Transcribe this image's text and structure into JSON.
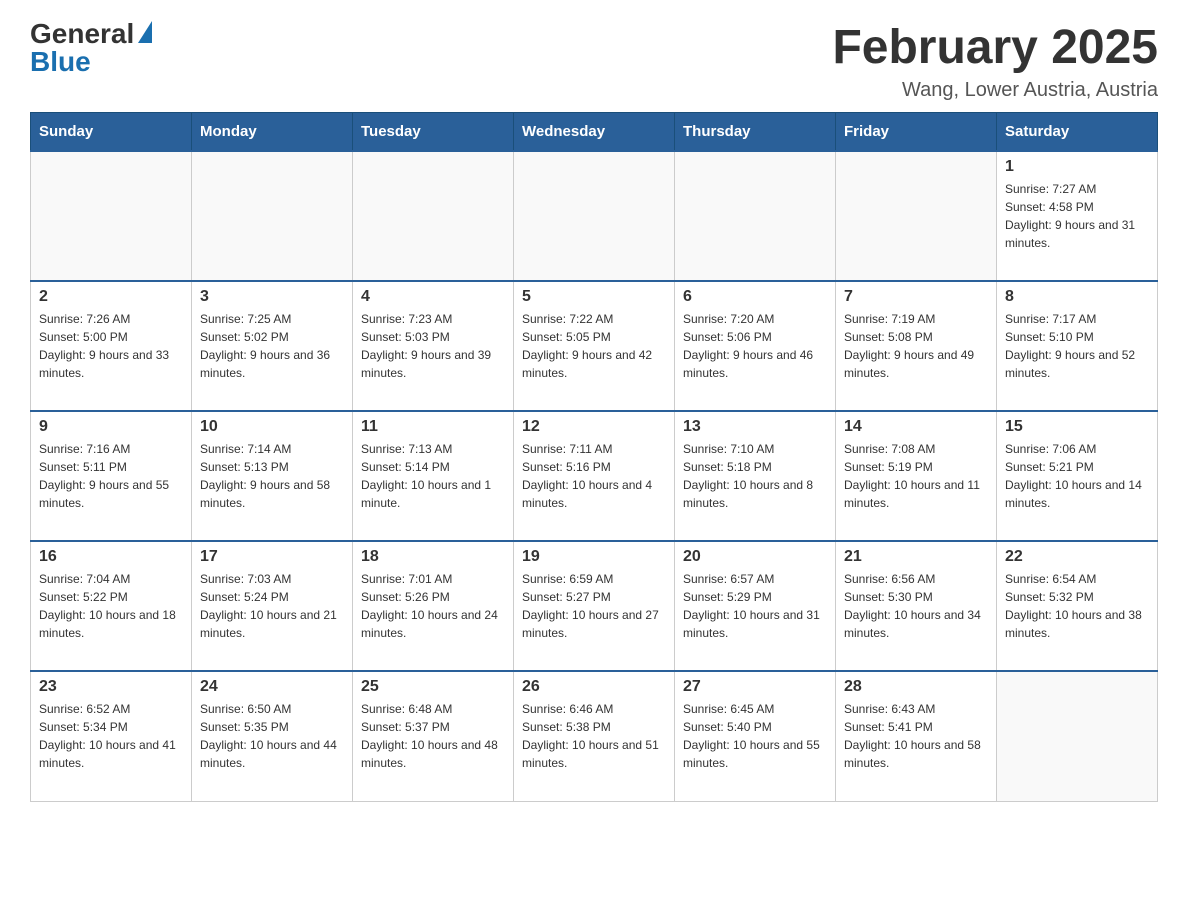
{
  "header": {
    "logo": {
      "general": "General",
      "blue": "Blue"
    },
    "title": "February 2025",
    "location": "Wang, Lower Austria, Austria"
  },
  "days_of_week": [
    "Sunday",
    "Monday",
    "Tuesday",
    "Wednesday",
    "Thursday",
    "Friday",
    "Saturday"
  ],
  "weeks": [
    [
      {
        "day": "",
        "info": ""
      },
      {
        "day": "",
        "info": ""
      },
      {
        "day": "",
        "info": ""
      },
      {
        "day": "",
        "info": ""
      },
      {
        "day": "",
        "info": ""
      },
      {
        "day": "",
        "info": ""
      },
      {
        "day": "1",
        "info": "Sunrise: 7:27 AM\nSunset: 4:58 PM\nDaylight: 9 hours and 31 minutes."
      }
    ],
    [
      {
        "day": "2",
        "info": "Sunrise: 7:26 AM\nSunset: 5:00 PM\nDaylight: 9 hours and 33 minutes."
      },
      {
        "day": "3",
        "info": "Sunrise: 7:25 AM\nSunset: 5:02 PM\nDaylight: 9 hours and 36 minutes."
      },
      {
        "day": "4",
        "info": "Sunrise: 7:23 AM\nSunset: 5:03 PM\nDaylight: 9 hours and 39 minutes."
      },
      {
        "day": "5",
        "info": "Sunrise: 7:22 AM\nSunset: 5:05 PM\nDaylight: 9 hours and 42 minutes."
      },
      {
        "day": "6",
        "info": "Sunrise: 7:20 AM\nSunset: 5:06 PM\nDaylight: 9 hours and 46 minutes."
      },
      {
        "day": "7",
        "info": "Sunrise: 7:19 AM\nSunset: 5:08 PM\nDaylight: 9 hours and 49 minutes."
      },
      {
        "day": "8",
        "info": "Sunrise: 7:17 AM\nSunset: 5:10 PM\nDaylight: 9 hours and 52 minutes."
      }
    ],
    [
      {
        "day": "9",
        "info": "Sunrise: 7:16 AM\nSunset: 5:11 PM\nDaylight: 9 hours and 55 minutes."
      },
      {
        "day": "10",
        "info": "Sunrise: 7:14 AM\nSunset: 5:13 PM\nDaylight: 9 hours and 58 minutes."
      },
      {
        "day": "11",
        "info": "Sunrise: 7:13 AM\nSunset: 5:14 PM\nDaylight: 10 hours and 1 minute."
      },
      {
        "day": "12",
        "info": "Sunrise: 7:11 AM\nSunset: 5:16 PM\nDaylight: 10 hours and 4 minutes."
      },
      {
        "day": "13",
        "info": "Sunrise: 7:10 AM\nSunset: 5:18 PM\nDaylight: 10 hours and 8 minutes."
      },
      {
        "day": "14",
        "info": "Sunrise: 7:08 AM\nSunset: 5:19 PM\nDaylight: 10 hours and 11 minutes."
      },
      {
        "day": "15",
        "info": "Sunrise: 7:06 AM\nSunset: 5:21 PM\nDaylight: 10 hours and 14 minutes."
      }
    ],
    [
      {
        "day": "16",
        "info": "Sunrise: 7:04 AM\nSunset: 5:22 PM\nDaylight: 10 hours and 18 minutes."
      },
      {
        "day": "17",
        "info": "Sunrise: 7:03 AM\nSunset: 5:24 PM\nDaylight: 10 hours and 21 minutes."
      },
      {
        "day": "18",
        "info": "Sunrise: 7:01 AM\nSunset: 5:26 PM\nDaylight: 10 hours and 24 minutes."
      },
      {
        "day": "19",
        "info": "Sunrise: 6:59 AM\nSunset: 5:27 PM\nDaylight: 10 hours and 27 minutes."
      },
      {
        "day": "20",
        "info": "Sunrise: 6:57 AM\nSunset: 5:29 PM\nDaylight: 10 hours and 31 minutes."
      },
      {
        "day": "21",
        "info": "Sunrise: 6:56 AM\nSunset: 5:30 PM\nDaylight: 10 hours and 34 minutes."
      },
      {
        "day": "22",
        "info": "Sunrise: 6:54 AM\nSunset: 5:32 PM\nDaylight: 10 hours and 38 minutes."
      }
    ],
    [
      {
        "day": "23",
        "info": "Sunrise: 6:52 AM\nSunset: 5:34 PM\nDaylight: 10 hours and 41 minutes."
      },
      {
        "day": "24",
        "info": "Sunrise: 6:50 AM\nSunset: 5:35 PM\nDaylight: 10 hours and 44 minutes."
      },
      {
        "day": "25",
        "info": "Sunrise: 6:48 AM\nSunset: 5:37 PM\nDaylight: 10 hours and 48 minutes."
      },
      {
        "day": "26",
        "info": "Sunrise: 6:46 AM\nSunset: 5:38 PM\nDaylight: 10 hours and 51 minutes."
      },
      {
        "day": "27",
        "info": "Sunrise: 6:45 AM\nSunset: 5:40 PM\nDaylight: 10 hours and 55 minutes."
      },
      {
        "day": "28",
        "info": "Sunrise: 6:43 AM\nSunset: 5:41 PM\nDaylight: 10 hours and 58 minutes."
      },
      {
        "day": "",
        "info": ""
      }
    ]
  ]
}
